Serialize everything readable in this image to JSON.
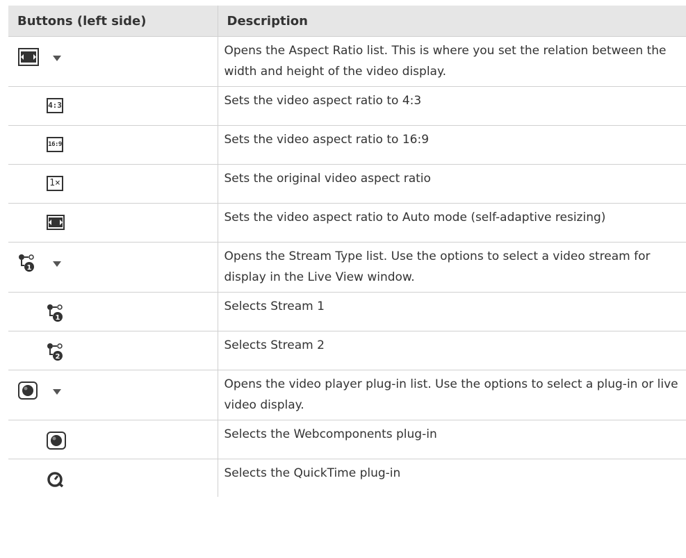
{
  "header": {
    "col_buttons": "Buttons (left side)",
    "col_description": "Description"
  },
  "rows": [
    {
      "icon": "aspect-ratio-list-icon",
      "description": "Opens the Aspect Ratio list. This is where you set the relation between the width and height of the video display."
    },
    {
      "icon": "aspect-4-3-icon",
      "icon_text": "4:3",
      "description": "Sets the video aspect ratio to 4:3"
    },
    {
      "icon": "aspect-16-9-icon",
      "icon_text": "16:9",
      "description": "Sets the video aspect ratio to 16:9"
    },
    {
      "icon": "aspect-original-icon",
      "icon_text": "1×",
      "description": "Sets the original video aspect ratio"
    },
    {
      "icon": "aspect-auto-icon",
      "description": "Sets the video aspect ratio to Auto mode (self-adaptive resizing)"
    },
    {
      "icon": "stream-type-list-icon",
      "description": "Opens the Stream Type list. Use the options to select a video stream for display in the Live View window."
    },
    {
      "icon": "stream-1-icon",
      "description": "Selects Stream 1"
    },
    {
      "icon": "stream-2-icon",
      "description": "Selects Stream 2"
    },
    {
      "icon": "plugin-list-icon",
      "description": "Opens the video player plug-in list. Use the options to select a plug-in or live video display."
    },
    {
      "icon": "webcomponents-plugin-icon",
      "description": "Selects the Webcomponents plug-in"
    },
    {
      "icon": "quicktime-plugin-icon",
      "description": "Selects the QuickTime plug-in"
    }
  ]
}
